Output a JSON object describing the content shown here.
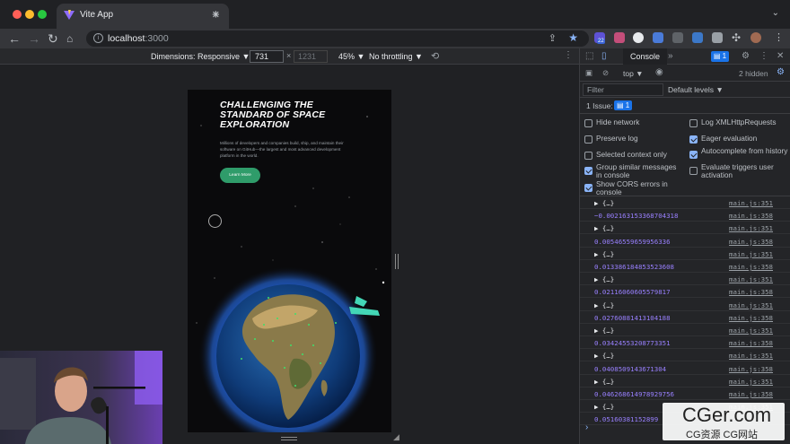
{
  "browser": {
    "tab_title": "Vite App",
    "tab_close": "✕",
    "new_tab": "+",
    "address_host": "localhost",
    "address_port": ":3000",
    "extension_badge": "22"
  },
  "device_toolbar": {
    "dimensions_label": "Dimensions: Responsive ▼",
    "width": "731",
    "height": "1231",
    "zoom": "45% ▼",
    "throttling": "No throttling ▼"
  },
  "page": {
    "hero_title": "CHALLENGING THE STANDARD OF SPACE EXPLORATION",
    "hero_text": "Millions of developers and companies build, ship, and maintain their software on GitHub—the largest and most advanced development platform in the world.",
    "cta_label": "Learn More"
  },
  "devtools": {
    "tab_console": "Console",
    "issues_badge": "1",
    "context": "top ▼",
    "hidden": "2 hidden",
    "filter_placeholder": "Filter",
    "levels": "Default levels ▼",
    "issue_label": "1 Issue:",
    "issue_count": "1",
    "settings": [
      {
        "label": "Hide network",
        "checked": false
      },
      {
        "label": "Log XMLHttpRequests",
        "checked": false
      },
      {
        "label": "Preserve log",
        "checked": false
      },
      {
        "label": "Eager evaluation",
        "checked": true
      },
      {
        "label": "Selected context only",
        "checked": false
      },
      {
        "label": "Autocomplete from history",
        "checked": true
      },
      {
        "label": "Group similar messages in console",
        "checked": true
      },
      {
        "label": "Evaluate triggers user activation",
        "checked": false
      },
      {
        "label": "Show CORS errors in console",
        "checked": true
      }
    ],
    "log": [
      {
        "kind": "obj",
        "text": "▶ {…}",
        "src": "main.js:351"
      },
      {
        "kind": "num",
        "text": "−0.002163153368704318",
        "src": "main.js:358"
      },
      {
        "kind": "obj",
        "text": "▶ {…}",
        "src": "main.js:351"
      },
      {
        "kind": "num",
        "text": "0.00546559659956336",
        "src": "main.js:358"
      },
      {
        "kind": "obj",
        "text": "▶ {…}",
        "src": "main.js:351"
      },
      {
        "kind": "num",
        "text": "0.013386184853523608",
        "src": "main.js:358"
      },
      {
        "kind": "obj",
        "text": "▶ {…}",
        "src": "main.js:351"
      },
      {
        "kind": "num",
        "text": "0.02116060605579817",
        "src": "main.js:358"
      },
      {
        "kind": "obj",
        "text": "▶ {…}",
        "src": "main.js:351"
      },
      {
        "kind": "num",
        "text": "0.02760881413104188",
        "src": "main.js:358"
      },
      {
        "kind": "obj",
        "text": "▶ {…}",
        "src": "main.js:351"
      },
      {
        "kind": "num",
        "text": "0.03424553208773351",
        "src": "main.js:358"
      },
      {
        "kind": "obj",
        "text": "▶ {…}",
        "src": "main.js:351"
      },
      {
        "kind": "num",
        "text": "0.0408509143671304",
        "src": "main.js:358"
      },
      {
        "kind": "obj",
        "text": "▶ {…}",
        "src": "main.js:351"
      },
      {
        "kind": "num",
        "text": "0.046268614978929756",
        "src": "main.js:358"
      },
      {
        "kind": "obj",
        "text": "▶ {…}",
        "src": "main.js:351"
      },
      {
        "kind": "num",
        "text": "0.05160381152899",
        "src": ""
      }
    ],
    "prompt": "›"
  },
  "watermark": {
    "big": "CGer.com",
    "small": "CG资源  CG网站"
  },
  "colors": {
    "accent_green": "#2f9c6a",
    "console_number": "#9980ff",
    "devtools_blue": "#1a73e8"
  }
}
